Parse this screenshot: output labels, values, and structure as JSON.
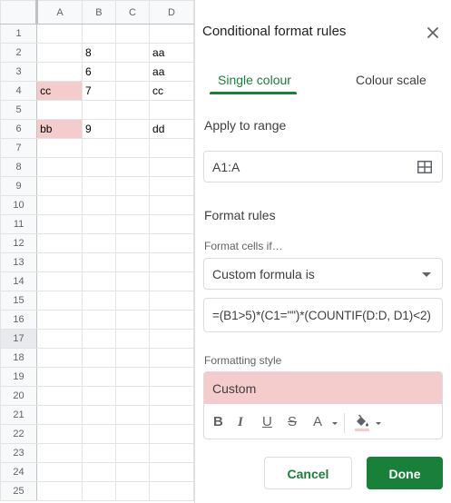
{
  "sheet": {
    "columns": [
      "A",
      "B",
      "C",
      "D"
    ],
    "rows": [
      {
        "num": "1",
        "a": "",
        "a_hl": false,
        "b": "",
        "c": "",
        "d": ""
      },
      {
        "num": "2",
        "a": "",
        "a_hl": false,
        "b": "8",
        "c": "",
        "d": "aa"
      },
      {
        "num": "3",
        "a": "",
        "a_hl": false,
        "b": "6",
        "c": "",
        "d": "aa"
      },
      {
        "num": "4",
        "a": "cc",
        "a_hl": true,
        "b": "7",
        "c": "",
        "d": "cc"
      },
      {
        "num": "5",
        "a": "",
        "a_hl": false,
        "b": "",
        "c": "",
        "d": ""
      },
      {
        "num": "6",
        "a": "bb",
        "a_hl": true,
        "b": "9",
        "c": "",
        "d": "dd"
      },
      {
        "num": "7",
        "a": "",
        "a_hl": false,
        "b": "",
        "c": "",
        "d": ""
      },
      {
        "num": "8",
        "a": "",
        "a_hl": false,
        "b": "",
        "c": "",
        "d": ""
      },
      {
        "num": "9",
        "a": "",
        "a_hl": false,
        "b": "",
        "c": "",
        "d": ""
      },
      {
        "num": "10",
        "a": "",
        "a_hl": false,
        "b": "",
        "c": "",
        "d": ""
      },
      {
        "num": "11",
        "a": "",
        "a_hl": false,
        "b": "",
        "c": "",
        "d": ""
      },
      {
        "num": "12",
        "a": "",
        "a_hl": false,
        "b": "",
        "c": "",
        "d": ""
      },
      {
        "num": "13",
        "a": "",
        "a_hl": false,
        "b": "",
        "c": "",
        "d": ""
      },
      {
        "num": "14",
        "a": "",
        "a_hl": false,
        "b": "",
        "c": "",
        "d": ""
      },
      {
        "num": "15",
        "a": "",
        "a_hl": false,
        "b": "",
        "c": "",
        "d": ""
      },
      {
        "num": "16",
        "a": "",
        "a_hl": false,
        "b": "",
        "c": "",
        "d": ""
      },
      {
        "num": "17",
        "a": "",
        "a_hl": false,
        "b": "",
        "c": "",
        "d": ""
      },
      {
        "num": "18",
        "a": "",
        "a_hl": false,
        "b": "",
        "c": "",
        "d": ""
      },
      {
        "num": "19",
        "a": "",
        "a_hl": false,
        "b": "",
        "c": "",
        "d": ""
      },
      {
        "num": "20",
        "a": "",
        "a_hl": false,
        "b": "",
        "c": "",
        "d": ""
      },
      {
        "num": "21",
        "a": "",
        "a_hl": false,
        "b": "",
        "c": "",
        "d": ""
      },
      {
        "num": "22",
        "a": "",
        "a_hl": false,
        "b": "",
        "c": "",
        "d": ""
      },
      {
        "num": "23",
        "a": "",
        "a_hl": false,
        "b": "",
        "c": "",
        "d": ""
      },
      {
        "num": "24",
        "a": "",
        "a_hl": false,
        "b": "",
        "c": "",
        "d": ""
      },
      {
        "num": "25",
        "a": "",
        "a_hl": false,
        "b": "",
        "c": "",
        "d": ""
      }
    ],
    "highlight_color": "#f4cccc"
  },
  "panel": {
    "title": "Conditional format rules",
    "close_icon": "close-icon",
    "tabs": {
      "single": "Single colour",
      "scale": "Colour scale",
      "active": "single"
    },
    "apply_to_range_label": "Apply to range",
    "range_value": "A1:A",
    "format_rules_label": "Format rules",
    "format_cells_if_label": "Format cells if…",
    "condition_value": "Custom formula is",
    "formula_value": "=(B1>5)*(C1=\"\")*(COUNTIF(D:D, D1)<2)",
    "formatting_style_label": "Formatting style",
    "style_preview_text": "Custom",
    "toolbar": {
      "bold": "B",
      "italic": "I",
      "underline": "U",
      "strikethrough": "S",
      "text_color": "A"
    },
    "cancel_label": "Cancel",
    "done_label": "Done",
    "accent_color": "#188038"
  }
}
